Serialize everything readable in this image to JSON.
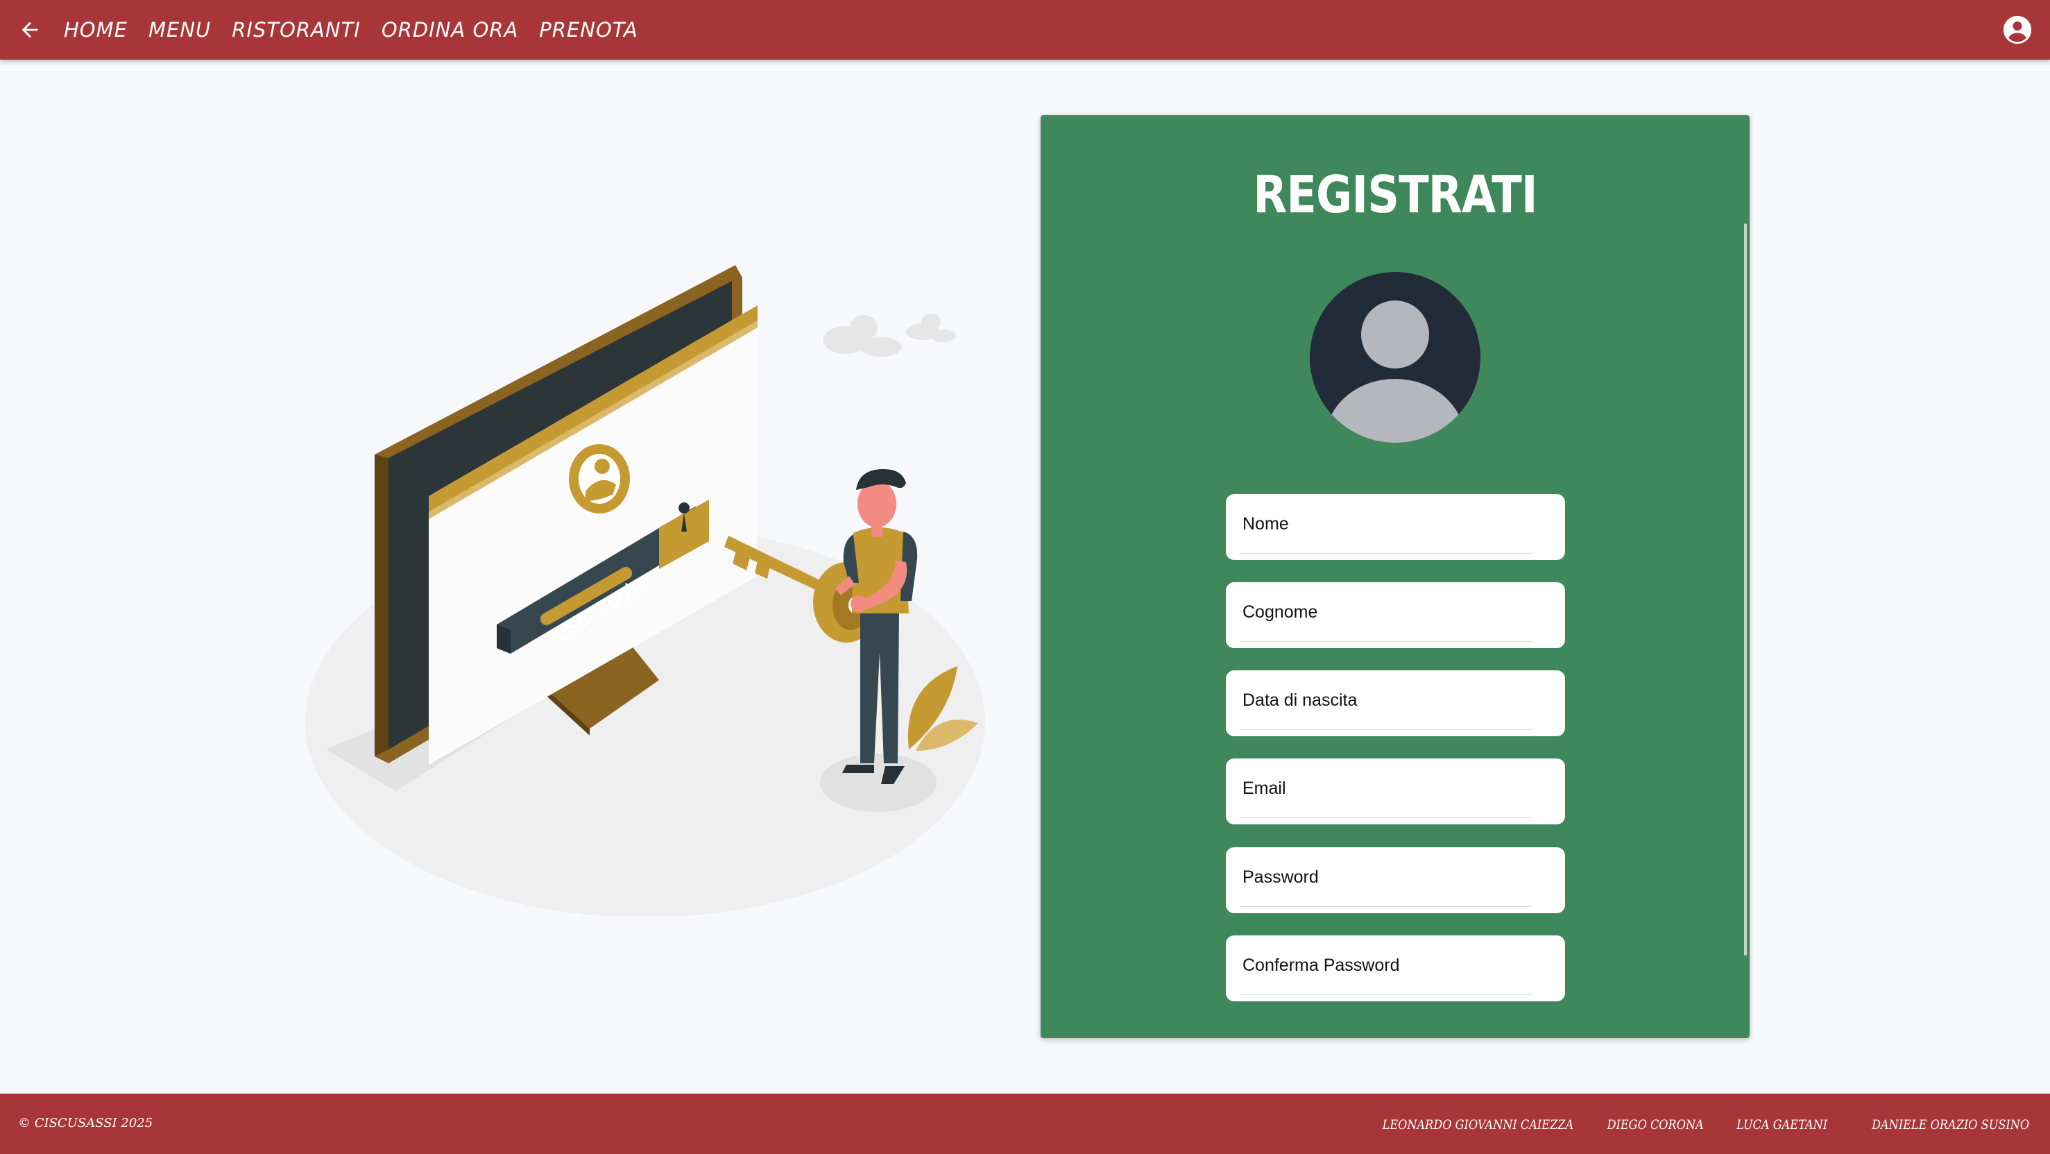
{
  "nav": {
    "links": [
      "HOME",
      "MENU",
      "RISTORANTI",
      "ORDINA ORA",
      "PRENOTA"
    ]
  },
  "illustration": {
    "screen_button_text": "User Login"
  },
  "card": {
    "title": "REGISTRATI",
    "fields": [
      "Nome",
      "Cognome",
      "Data di nascita",
      "Email",
      "Password",
      "Conferma Password"
    ]
  },
  "footer": {
    "copyright": "© CISCUSASSI 2025",
    "authors": [
      "LEONARDO GIOVANNI CAIEZZA",
      "DIEGO CORONA",
      "LUCA GAETANI",
      "DANIELE ORAZIO SUSINO"
    ]
  },
  "colors": {
    "brand_red": "#a83538",
    "card_green": "#3e885b",
    "gold": "#c69a32",
    "dark_slate": "#263238"
  }
}
